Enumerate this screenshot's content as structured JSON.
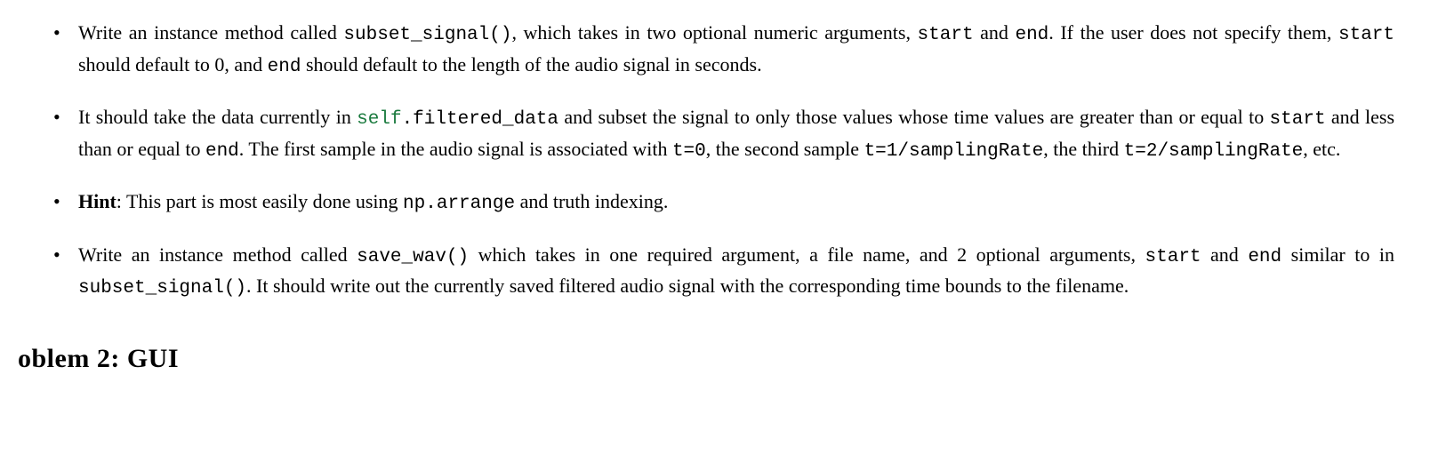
{
  "bullets": {
    "b1": {
      "part1": "Write an instance method called ",
      "code1": "subset_signal()",
      "part2": ", which takes in two optional numeric arguments, ",
      "code2": "start",
      "part3": " and ",
      "code3": "end",
      "part4": ". If the user does not specify them, ",
      "code4": "start",
      "part5": " should default to 0, and ",
      "code5": "end",
      "part6": " should default to the length of the audio signal in seconds."
    },
    "b2": {
      "part1": "It should take the data currently in ",
      "code1a": "self",
      "code1b": ".filtered_data",
      "part2": " and subset the signal to only those values whose time values are greater than or equal to ",
      "code2": "start",
      "part3": " and less than or equal to ",
      "code3": "end",
      "part4": ". The first sample in the audio signal is associated with ",
      "code4": "t=0",
      "part5": ", the second sample ",
      "code5": "t=1/samplingRate",
      "part6": ", the third ",
      "code6": "t=2/samplingRate",
      "part7": ", etc."
    },
    "b3": {
      "bold1": "Hint",
      "part1": ": This part is most easily done using ",
      "code1": "np.arrange",
      "part2": " and truth indexing."
    },
    "b4": {
      "part1": "Write an instance method called ",
      "code1": "save_wav()",
      "part2": " which takes in one required argument, a file name, and 2 optional arguments, ",
      "code2": "start",
      "part3": " and ",
      "code3": "end",
      "part4": " similar to in ",
      "code4": "subset_signal()",
      "part5": ". It should write out the currently saved filtered audio signal with the corresponding time bounds to the filename."
    }
  },
  "heading_fragment": "oblem 2: GUI"
}
